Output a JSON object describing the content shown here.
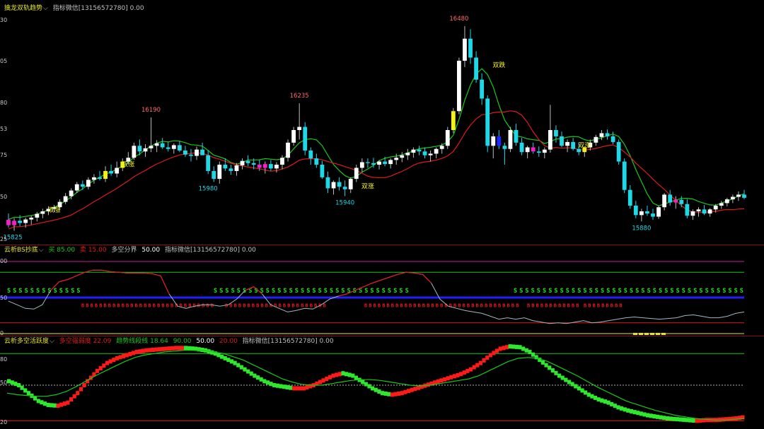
{
  "top_status": "",
  "panels": {
    "main": {
      "indicator_name": "擒龙双轨趋势",
      "chevron": "⌵",
      "note": "指标微信[13156572780] 0.00",
      "y_ticks": [
        "30",
        "05",
        "80",
        "53",
        "75",
        "50",
        "25"
      ],
      "peak_labels": [
        "16190",
        "16235",
        "16480",
        "15880",
        "15940",
        "15980",
        "15825"
      ],
      "markers": [
        "双涨",
        "双涨",
        "双涨",
        "双跌",
        "双涨"
      ]
    },
    "bs": {
      "indicator_name": "云析BS抄底",
      "chevron": "⌵",
      "buy_label": "买 85.00",
      "sell_label": "卖 15.00",
      "split_label": "多空分界",
      "split_value": "50.00",
      "note": "指标微信[13156572780] 0.00",
      "y_ticks": [
        "00",
        "50",
        "0"
      ]
    },
    "active": {
      "indicator_name": "云析多空活跃度",
      "chevron": "⌵",
      "item1": "多空强弱度 22.09",
      "item2": "趋势线段线 18.64",
      "v1": "90.00",
      "v2": "50.00",
      "v3": "20.00",
      "note": "指标微信[13156572780] 0.00",
      "y_ticks": [
        "80",
        "50",
        "20"
      ]
    }
  },
  "colors": {
    "up_body": "#ffffff",
    "down_body": "#1ed8e8",
    "magenta": "#ff1ad0",
    "yellow": "#f2f21a",
    "blue": "#1a2aff",
    "red_line": "#e01a1a",
    "green_line": "#19c819",
    "bs_green": "#19e619",
    "bs_red": "#e61a1a",
    "cyan_line": "#9fb9c0"
  },
  "chart_data": [
    {
      "type": "candlestick",
      "title": "擒龙双轨趋势",
      "ylim": [
        15800,
        16500
      ],
      "ohlc": [
        [
          15865,
          15885,
          15840,
          15848
        ],
        [
          15848,
          15870,
          15830,
          15862
        ],
        [
          15862,
          15880,
          15845,
          15855
        ],
        [
          15855,
          15872,
          15840,
          15866
        ],
        [
          15866,
          15878,
          15850,
          15872
        ],
        [
          15872,
          15890,
          15860,
          15884
        ],
        [
          15884,
          15900,
          15870,
          15892
        ],
        [
          15892,
          15908,
          15880,
          15900
        ],
        [
          15900,
          15912,
          15890,
          15905
        ],
        [
          15905,
          15930,
          15895,
          15922
        ],
        [
          15922,
          15950,
          15915,
          15940
        ],
        [
          15940,
          15965,
          15930,
          15958
        ],
        [
          15958,
          15985,
          15950,
          15978
        ],
        [
          15978,
          15990,
          15960,
          15970
        ],
        [
          15970,
          16000,
          15962,
          15992
        ],
        [
          15992,
          16010,
          15980,
          16000
        ],
        [
          16000,
          16020,
          15990,
          15995
        ],
        [
          15995,
          16035,
          15985,
          16020
        ],
        [
          16020,
          16040,
          16005,
          16012
        ],
        [
          16012,
          16050,
          16000,
          16030
        ],
        [
          16030,
          16060,
          16020,
          16050
        ],
        [
          16050,
          16080,
          16040,
          16062
        ],
        [
          16062,
          16110,
          16055,
          16100
        ],
        [
          16100,
          16120,
          16070,
          16082
        ],
        [
          16082,
          16105,
          16065,
          16092
        ],
        [
          16092,
          16190,
          16080,
          16100
        ],
        [
          16100,
          16118,
          16080,
          16108
        ],
        [
          16108,
          16125,
          16090,
          16095
        ],
        [
          16095,
          16112,
          16082,
          16090
        ],
        [
          16090,
          16108,
          16075,
          16102
        ],
        [
          16102,
          16115,
          16080,
          16085
        ],
        [
          16085,
          16100,
          16065,
          16072
        ],
        [
          16072,
          16090,
          16050,
          16068
        ],
        [
          16068,
          16098,
          16055,
          16088
        ],
        [
          16088,
          16110,
          16075,
          16070
        ],
        [
          16070,
          16085,
          16010,
          16020
        ],
        [
          16020,
          16035,
          15985,
          15995
        ],
        [
          15995,
          16050,
          15980,
          16040
        ],
        [
          16040,
          16060,
          16020,
          16028
        ],
        [
          16028,
          16040,
          16008,
          16020
        ],
        [
          16020,
          16045,
          16005,
          16038
        ],
        [
          16038,
          16060,
          16025,
          16052
        ],
        [
          16052,
          16070,
          16035,
          16045
        ],
        [
          16045,
          16060,
          16025,
          16040
        ],
        [
          16040,
          16055,
          16020,
          16030
        ],
        [
          16030,
          16050,
          16012,
          16042
        ],
        [
          16042,
          16055,
          16020,
          16028
        ],
        [
          16028,
          16048,
          16015,
          16040
        ],
        [
          16040,
          16070,
          16025,
          16062
        ],
        [
          16062,
          16120,
          16050,
          16110
        ],
        [
          16110,
          16160,
          16100,
          16150
        ],
        [
          16150,
          16235,
          16120,
          16160
        ],
        [
          16160,
          16175,
          16070,
          16085
        ],
        [
          16085,
          16095,
          16040,
          16060
        ],
        [
          16060,
          16075,
          16030,
          16040
        ],
        [
          16040,
          16052,
          15995,
          16000
        ],
        [
          16000,
          16018,
          15950,
          15965
        ],
        [
          15965,
          15990,
          15945,
          15985
        ],
        [
          15985,
          16000,
          15958,
          15970
        ],
        [
          15970,
          15990,
          15940,
          15962
        ],
        [
          15962,
          16000,
          15950,
          15995
        ],
        [
          15995,
          16040,
          15985,
          16030
        ],
        [
          16030,
          16060,
          16015,
          16048
        ],
        [
          16048,
          16060,
          16030,
          16045
        ],
        [
          16045,
          16062,
          16030,
          16040
        ],
        [
          16040,
          16055,
          16025,
          16050
        ],
        [
          16050,
          16065,
          16035,
          16042
        ],
        [
          16042,
          16060,
          16028,
          16055
        ],
        [
          16055,
          16075,
          16040,
          16062
        ],
        [
          16062,
          16080,
          16048,
          16070
        ],
        [
          16070,
          16090,
          16055,
          16078
        ],
        [
          16078,
          16095,
          16062,
          16088
        ],
        [
          16088,
          16100,
          16070,
          16082
        ],
        [
          16082,
          16095,
          16060,
          16070
        ],
        [
          16070,
          16085,
          16050,
          16075
        ],
        [
          16075,
          16095,
          16060,
          16090
        ],
        [
          16090,
          16108,
          16075,
          16100
        ],
        [
          16100,
          16160,
          16090,
          16150
        ],
        [
          16150,
          16220,
          16140,
          16210
        ],
        [
          16210,
          16380,
          16200,
          16370
        ],
        [
          16370,
          16480,
          16350,
          16440
        ],
        [
          16440,
          16470,
          16360,
          16380
        ],
        [
          16380,
          16400,
          16300,
          16310
        ],
        [
          16310,
          16330,
          16230,
          16250
        ],
        [
          16250,
          16260,
          16080,
          16100
        ],
        [
          16100,
          16140,
          16060,
          16130
        ],
        [
          16130,
          16150,
          16090,
          16100
        ],
        [
          16100,
          16110,
          16040,
          16090
        ],
        [
          16090,
          16160,
          16080,
          16150
        ],
        [
          16150,
          16170,
          16100,
          16110
        ],
        [
          16110,
          16125,
          16070,
          16080
        ],
        [
          16080,
          16100,
          16060,
          16095
        ],
        [
          16095,
          16110,
          16075,
          16082
        ],
        [
          16082,
          16098,
          16065,
          16078
        ],
        [
          16078,
          16095,
          16060,
          16088
        ],
        [
          16088,
          16230,
          16078,
          16150
        ],
        [
          16150,
          16165,
          16110,
          16130
        ],
        [
          16130,
          16145,
          16095,
          16100
        ],
        [
          16100,
          16120,
          16080,
          16112
        ],
        [
          16112,
          16125,
          16085,
          16090
        ],
        [
          16090,
          16110,
          16070,
          16080
        ],
        [
          16080,
          16098,
          16065,
          16095
        ],
        [
          16095,
          16120,
          16085,
          16110
        ],
        [
          16110,
          16135,
          16100,
          16128
        ],
        [
          16128,
          16150,
          16118,
          16140
        ],
        [
          16140,
          16152,
          16120,
          16130
        ],
        [
          16130,
          16145,
          16105,
          16112
        ],
        [
          16112,
          16120,
          16040,
          16050
        ],
        [
          16050,
          16060,
          15950,
          15960
        ],
        [
          15960,
          15975,
          15900,
          15910
        ],
        [
          15910,
          15925,
          15870,
          15880
        ],
        [
          15880,
          15900,
          15860,
          15892
        ],
        [
          15892,
          15910,
          15878,
          15885
        ],
        [
          15885,
          15900,
          15865,
          15875
        ],
        [
          15875,
          15910,
          15868,
          15905
        ],
        [
          15905,
          15950,
          15895,
          15945
        ],
        [
          15945,
          15960,
          15910,
          15920
        ],
        [
          15920,
          15940,
          15900,
          15928
        ],
        [
          15928,
          15940,
          15905,
          15915
        ],
        [
          15915,
          15930,
          15870,
          15878
        ],
        [
          15878,
          15898,
          15865,
          15892
        ],
        [
          15892,
          15905,
          15875,
          15898
        ],
        [
          15898,
          15912,
          15880,
          15885
        ],
        [
          15885,
          15902,
          15875,
          15898
        ],
        [
          15898,
          15915,
          15888,
          15910
        ],
        [
          15910,
          15925,
          15900,
          15918
        ],
        [
          15918,
          15935,
          15908,
          15930
        ],
        [
          15930,
          15945,
          15918,
          15938
        ],
        [
          15938,
          15955,
          15925,
          15945
        ],
        [
          15945,
          15960,
          15930,
          15935
        ]
      ]
    },
    {
      "type": "line",
      "title": "云析BS抄底",
      "ylim": [
        0,
        100
      ],
      "series": [
        {
          "values": [
            45,
            40,
            35,
            34,
            40,
            60,
            72,
            75,
            80,
            85,
            88,
            88,
            86,
            85,
            84,
            84,
            84,
            83,
            80,
            55,
            38,
            35,
            38,
            40,
            40,
            38,
            40,
            48,
            60,
            65,
            55,
            40,
            35,
            30,
            32,
            35,
            34,
            40,
            48,
            52,
            55,
            60,
            65,
            70,
            74,
            78,
            82,
            85,
            84,
            82,
            70,
            48,
            38,
            35,
            32,
            30,
            28,
            24,
            20,
            22,
            20,
            22,
            18,
            16,
            14,
            15,
            14,
            16,
            18,
            15,
            16,
            18,
            20,
            22,
            23,
            22,
            21,
            20,
            21,
            22,
            25,
            26,
            24,
            22,
            22,
            24,
            28,
            30
          ]
        }
      ]
    },
    {
      "type": "line",
      "title": "云析多空活跃度",
      "ylim": [
        0,
        100
      ],
      "series": [
        {
          "values": [
            55,
            50,
            40,
            30,
            25,
            24,
            28,
            40,
            55,
            68,
            78,
            84,
            88,
            92,
            94,
            95,
            96,
            97,
            97,
            96,
            94,
            90,
            84,
            78,
            70,
            62,
            55,
            50,
            48,
            46,
            46,
            50,
            56,
            62,
            65,
            62,
            54,
            46,
            40,
            38,
            40,
            44,
            48,
            52,
            56,
            60,
            64,
            70,
            78,
            88,
            96,
            99,
            98,
            92,
            82,
            72,
            62,
            54,
            46,
            38,
            32,
            28,
            22,
            18,
            15,
            12,
            10,
            8,
            7,
            6,
            5,
            6,
            6,
            7,
            8,
            10
          ]
        },
        {
          "values": [
            40,
            38,
            37,
            36,
            36,
            38,
            42,
            48,
            55,
            62,
            68,
            74,
            80,
            85,
            88,
            90,
            92,
            93,
            94,
            94,
            94,
            92,
            90,
            86,
            82,
            76,
            70,
            64,
            58,
            54,
            51,
            50,
            50,
            52,
            54,
            56,
            57,
            57,
            56,
            54,
            52,
            50,
            49,
            50,
            52,
            54,
            56,
            58,
            62,
            68,
            74,
            80,
            84,
            85,
            84,
            80,
            74,
            68,
            62,
            55,
            48,
            42,
            36,
            30,
            26,
            22,
            18,
            15,
            12,
            10,
            8,
            7,
            6,
            6,
            7,
            8
          ]
        }
      ]
    }
  ]
}
